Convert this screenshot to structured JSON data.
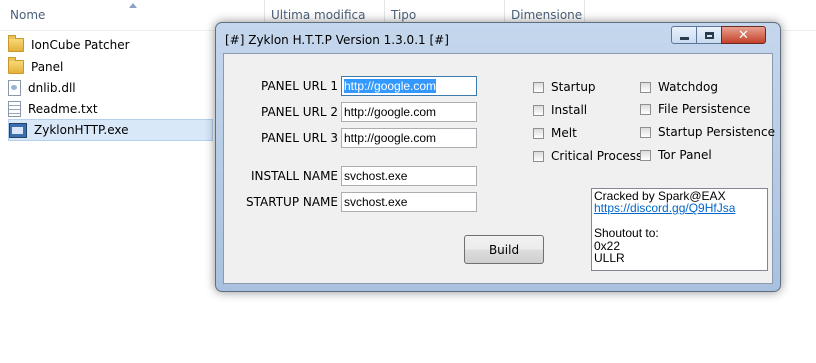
{
  "explorer": {
    "columns": {
      "name": "Nome",
      "modified": "Ultima modifica",
      "type": "Tipo",
      "size": "Dimensione"
    },
    "files": [
      {
        "name": "IonCube Patcher",
        "icon": "folder-icon"
      },
      {
        "name": "Panel",
        "icon": "folder-icon"
      },
      {
        "name": "dnlib.dll",
        "icon": "dll-file-icon"
      },
      {
        "name": "Readme.txt",
        "icon": "text-file-icon"
      },
      {
        "name": "ZyklonHTTP.exe",
        "icon": "exe-file-icon",
        "selected": true
      }
    ]
  },
  "window": {
    "title": "[#] Zyklon H.T.T.P Version 1.3.0.1 [#]",
    "controls": {
      "close": "✕"
    }
  },
  "form": {
    "panel_url_1": {
      "label": "PANEL URL 1",
      "value": "http://google.com"
    },
    "panel_url_2": {
      "label": "PANEL URL 2",
      "value": "http://google.com"
    },
    "panel_url_3": {
      "label": "PANEL URL 3",
      "value": "http://google.com"
    },
    "install_name": {
      "label": "INSTALL NAME",
      "value": "svchost.exe"
    },
    "startup_name": {
      "label": "STARTUP NAME",
      "value": "svchost.exe"
    }
  },
  "options": {
    "left": [
      {
        "label": "Startup",
        "checked": false
      },
      {
        "label": "Install",
        "checked": false
      },
      {
        "label": "Melt",
        "checked": false
      },
      {
        "label": "Critical Process",
        "checked": false
      }
    ],
    "right": [
      {
        "label": "Watchdog",
        "checked": false
      },
      {
        "label": "File Persistence",
        "checked": false
      },
      {
        "label": "Startup Persistence",
        "checked": false
      },
      {
        "label": "Tor Panel",
        "checked": false
      }
    ]
  },
  "build_label": "Build",
  "credits": {
    "line1": "Cracked by Spark@EAX",
    "link": "https://discord.gg/Q9HfJsa",
    "line3": "",
    "line4": "Shoutout to:",
    "line5": "0x22",
    "line6": "ULLR"
  }
}
